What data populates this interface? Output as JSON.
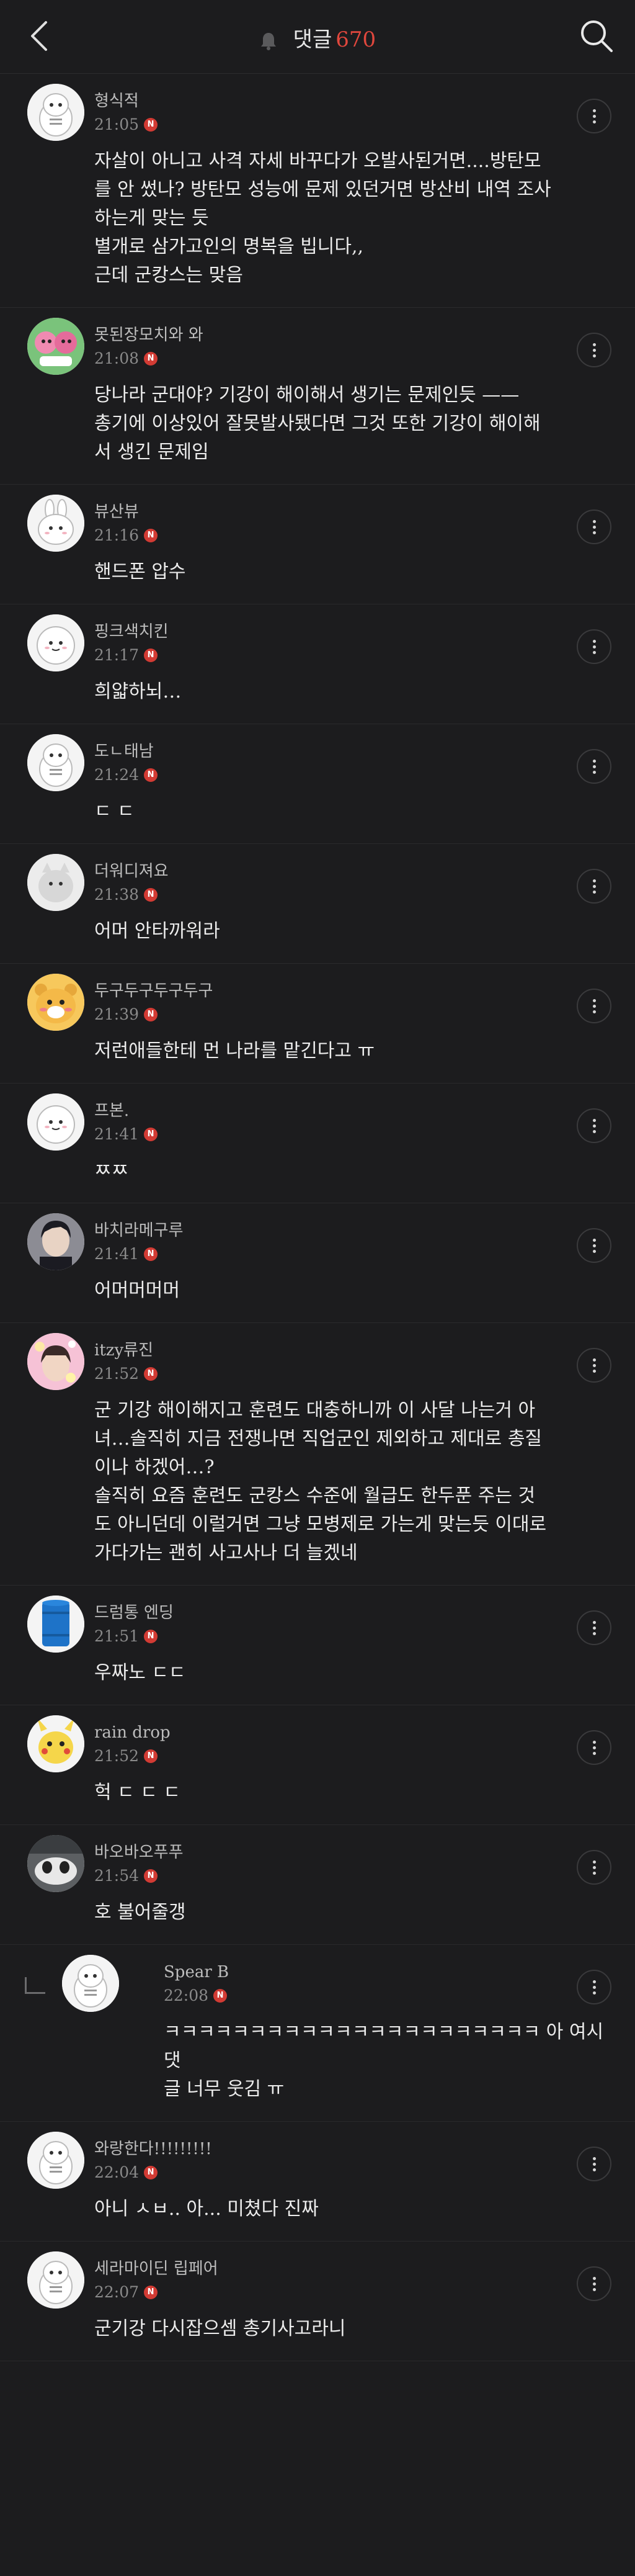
{
  "header": {
    "title": "댓글",
    "count": "670",
    "back_icon": "chevron-left-icon",
    "bell_icon": "bell-icon",
    "search_icon": "search-icon"
  },
  "comments": [
    {
      "author": "형식적",
      "time": "21:05",
      "badge": "N",
      "avatar": "white-mascot",
      "text": "자살이 아니고 사격 자세 바꾸다가 오발사된거면....방탄모\n를 안 썼나? 방탄모 성능에 문제 있던거면 방산비 내역 조사\n하는게 맞는 듯\n별개로 삼가고인의 명복을 빕니다,,\n근데 군캉스는 맞음"
    },
    {
      "author": "못된장모치와 와",
      "time": "21:08",
      "badge": "N",
      "avatar": "pink-character",
      "text": "당나라 군대야? 기강이 해이해서 생기는 문제인듯 ——\n총기에 이상있어 잘못발사됐다면 그것 또한 기강이 해이해\n서 생긴 문제임"
    },
    {
      "author": "뷰산뷰",
      "time": "21:16",
      "badge": "N",
      "avatar": "white-bunny",
      "text": "핸드폰 압수"
    },
    {
      "author": "핑크색치킨",
      "time": "21:17",
      "badge": "N",
      "avatar": "white-blob",
      "text": "희얇하뇌…"
    },
    {
      "author": "도ㄴ태남",
      "time": "21:24",
      "badge": "N",
      "avatar": "white-mascot",
      "text": "ㄷ ㄷ"
    },
    {
      "author": "더워디져요",
      "time": "21:38",
      "badge": "N",
      "avatar": "gray-cat",
      "text": "어머 안타까워라"
    },
    {
      "author": "두구두구두구두구",
      "time": "21:39",
      "badge": "N",
      "avatar": "yellow-bear",
      "text": "저런애들한테 먼 나라를 맡긴다고 ㅠ"
    },
    {
      "author": "프본.",
      "time": "21:41",
      "badge": "N",
      "avatar": "white-blob",
      "text": "ㅉㅉ"
    },
    {
      "author": "바치라메구루",
      "time": "21:41",
      "badge": "N",
      "avatar": "dark-portrait",
      "text": "어머머머머"
    },
    {
      "author": "itzy류진",
      "time": "21:52",
      "badge": "N",
      "avatar": "pink-photo",
      "text": "군 기강 해이해지고 훈련도 대충하니까 이 사달 나는거 아\n녀…솔직히 지금 전쟁나면 직업군인 제외하고 제대로 총질\n이나 하겠어…?\n솔직히 요즘 훈련도 군캉스 수준에 월급도 한두푼 주는 것\n도 아니던데 이럴거면 그냥 모병제로 가는게 맞는듯 이대로\n가다가는 괜히 사고사나 더 늘겠네"
    },
    {
      "author": "드럼통 엔딩",
      "time": "21:51",
      "badge": "N",
      "avatar": "blue-drum",
      "text": "우짜노 ㄷㄷ"
    },
    {
      "author": "rain drop",
      "time": "21:52",
      "badge": "N",
      "avatar": "pikachu",
      "text": "헉 ㄷ ㄷ ㄷ"
    },
    {
      "author": "바오바오푸푸",
      "time": "21:54",
      "badge": "N",
      "avatar": "panda-photo",
      "text": "호 불어줄갱"
    },
    {
      "author": "Spear B",
      "time": "22:08",
      "badge": "N",
      "avatar": "white-mascot",
      "reply": true,
      "text": "ㅋㅋㅋㅋㅋㅋㅋㅋㅋㅋㅋㅋㅋㅋㅋㅋㅋㅋㅋㅋㅋㅋ 아 여시 댓\n글 너무 웃김 ㅠ"
    },
    {
      "author": "와랑한다!!!!!!!!!",
      "time": "22:04",
      "badge": "N",
      "avatar": "white-mascot",
      "text": "아니 ㅅㅂ.. 아... 미쳤다 진짜"
    },
    {
      "author": "세라마이딘 립페어",
      "time": "22:07",
      "badge": "N",
      "avatar": "white-mascot",
      "text": "군기강 다시잡으셈 총기사고라니"
    }
  ]
}
